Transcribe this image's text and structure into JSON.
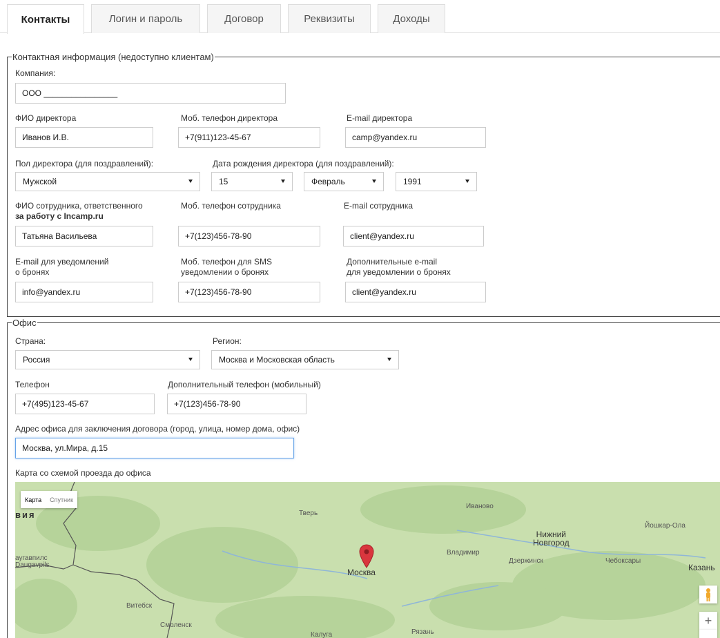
{
  "tabs": [
    "Контакты",
    "Логин и пароль",
    "Договор",
    "Реквизиты",
    "Доходы"
  ],
  "contact": {
    "legend": "Контактная информация (недоступно клиентам)",
    "company_label": "Компания:",
    "company_value": "ООО ________________",
    "director_name_label": "ФИО директора",
    "director_name_value": "Иванов И.В.",
    "director_phone_label": "Моб. телефон директора",
    "director_phone_value": "+7(911)123-45-67",
    "director_email_label": "E-mail директора",
    "director_email_value": "camp@yandex.ru",
    "gender_label": "Пол директора (для поздравлений):",
    "gender_value": "Мужской",
    "birthday_label": "Дата рождения директора (для поздравлений):",
    "birth_day": "15",
    "birth_month": "Февраль",
    "birth_year": "1991",
    "employee_name_label_1": "ФИО сотрудника, ответственного",
    "employee_name_label_2": "за работу с Incamp.ru",
    "employee_name_value": "Татьяна Васильева",
    "employee_phone_label": "Моб. телефон сотрудника",
    "employee_phone_value": "+7(123)456-78-90",
    "employee_email_label": "E-mail сотрудника",
    "employee_email_value": "client@yandex.ru",
    "notify_email_label_1": "E-mail для уведомлений",
    "notify_email_label_2": "о бронях",
    "notify_email_value": "info@yandex.ru",
    "sms_phone_label_1": "Моб. телефон для SMS",
    "sms_phone_label_2": "уведомлении о бронях",
    "sms_phone_value": "+7(123)456-78-90",
    "extra_email_label_1": "Дополнительные e-mail",
    "extra_email_label_2": "для уведомлении о бронях",
    "extra_email_value": "client@yandex.ru"
  },
  "office": {
    "legend": "Офис",
    "country_label": "Страна:",
    "country_value": "Россия",
    "region_label": "Регион:",
    "region_value": "Москва и Московская область",
    "phone_label": "Телефон",
    "phone_value": "+7(495)123-45-67",
    "extra_phone_label": "Дополнительный телефон (мобильный)",
    "extra_phone_value": "+7(123)456-78-90",
    "address_label": "Адрес офиса для заключения договора (город, улица, номер дома, офис)",
    "address_value": "Москва, ул.Мира, д.15",
    "map_label": "Карта со схемой проезда до офиса"
  },
  "map": {
    "btn_map": "Карта",
    "btn_sat": "Спутник",
    "cities": {
      "tver": "Тверь",
      "ivanovo": "Иваново",
      "yoshkar": "Йошкар-Ола",
      "nizhny_1": "Нижний",
      "nizhny_2": "Новгород",
      "vladimir": "Владимир",
      "dzerzhinsk": "Дзержинск",
      "cheboksary": "Чебоксары",
      "kazan": "Казань",
      "moscow": "Москва",
      "daugavpils_1": "аугавпилс",
      "daugavpils_2": "Daugavpils",
      "vitebsk": "Витебск",
      "smolensk": "Смоленск",
      "kaluga": "Калуга",
      "ryazan": "Рязань",
      "partial": "вия"
    },
    "zoom_in": "+",
    "zoom_out": "−",
    "colors": {
      "land": "#c9dfae",
      "forest": "#b6d39a",
      "marker": "#d9363e"
    }
  }
}
